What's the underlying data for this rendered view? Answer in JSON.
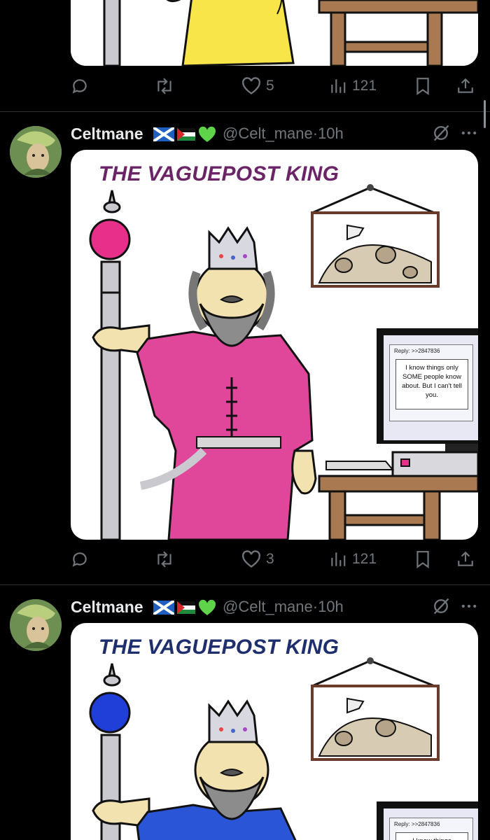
{
  "posts": [
    {
      "actions": {
        "reply_count": "",
        "repost_count": "",
        "like_count": "5",
        "views_count": "121"
      }
    },
    {
      "author": {
        "name": "Celtmane",
        "handle": "@Celt_mane",
        "time": "10h"
      },
      "comic": {
        "title": "THE VAGUEPOST KING",
        "title_color": "#6b2566",
        "staff_orb_color": "#e8308a",
        "robe_color": "#e0479a",
        "reply_header": "Reply: >>2847836",
        "reply_text": "I know things only SOME people know about. But I can't tell you."
      },
      "actions": {
        "reply_count": "",
        "repost_count": "",
        "like_count": "3",
        "views_count": "121"
      }
    },
    {
      "author": {
        "name": "Celtmane",
        "handle": "@Celt_mane",
        "time": "10h"
      },
      "comic": {
        "title": "THE VAGUEPOST KING",
        "title_color": "#1f2f6e",
        "staff_orb_color": "#1f3fd8",
        "robe_color": "#2a55d6",
        "reply_header": "Reply: >>2847836",
        "reply_text": "I know things"
      }
    }
  ],
  "icons": {
    "reply": "reply-icon",
    "repost": "repost-icon",
    "like": "like-icon",
    "views": "views-icon",
    "bookmark": "bookmark-icon",
    "share": "share-icon",
    "grok": "grok-icon",
    "more": "more-icon"
  },
  "flags": [
    "scotland-flag",
    "palestine-flag",
    "green-heart"
  ],
  "colors": {
    "background": "#000000",
    "text": "#e7e9ea",
    "muted": "#71767b",
    "divider": "#2f3336"
  }
}
